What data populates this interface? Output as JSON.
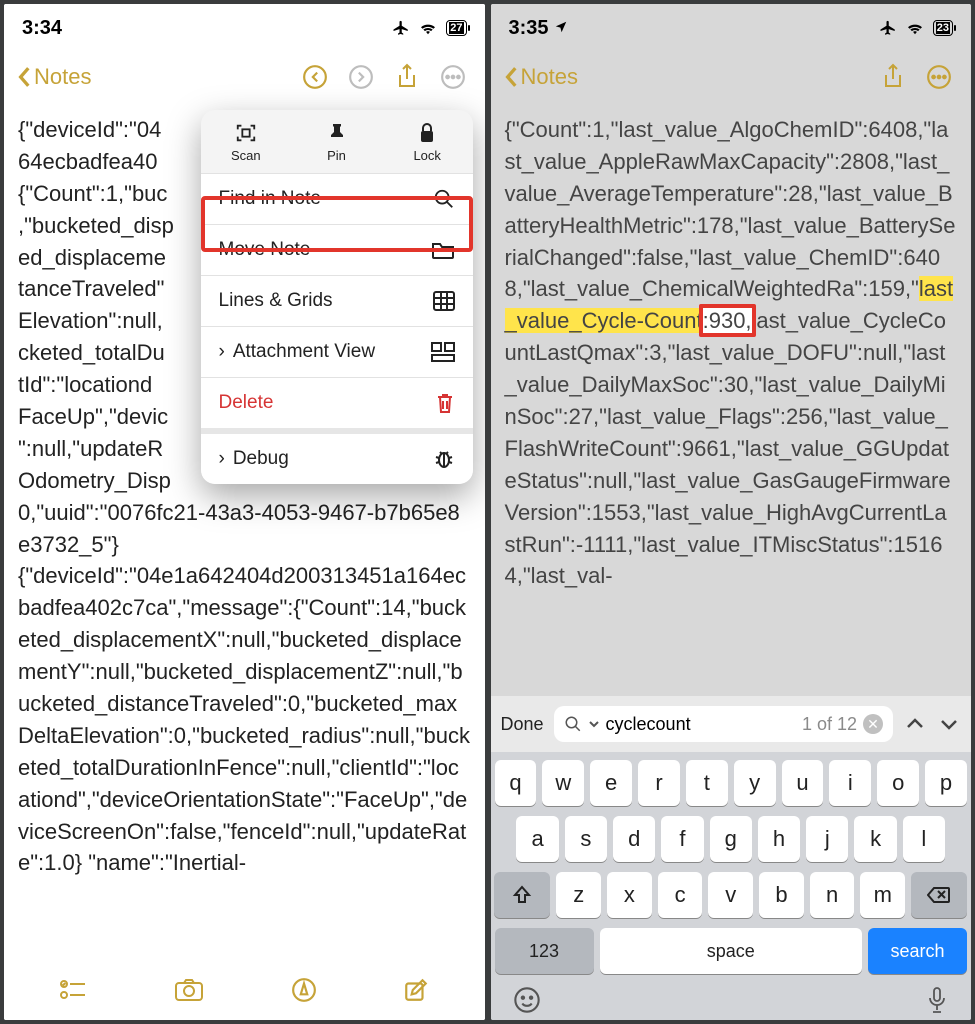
{
  "left": {
    "time": "3:34",
    "battery": "27",
    "back_label": "Notes",
    "note_body_pre": "{\"deviceId\":\"04\n64ecbadfea40\n{\"Count\":1,\"buc\n,\"bucketed_disp\ned_displaceme\ntanceTraveled\"\nElevation\":null,\ncketed_totalDu\ntId\":\"locationd\nFaceUp\",\"devic\n\":null,\"updateR\nOdometry_Disp\n0,\"uuid\":\"0076fc21-43a3-4053-9467-b7b65e8e3732_5\"}\n{\"deviceId\":\"04e1a642404d200313451a164ecbadfea402c7ca\",\"message\":{\"Count\":14,\"bucketed_displacementX\":null,\"bucketed_displacementY\":null,\"bucketed_displacementZ\":null,\"bucketed_distanceTraveled\":0,\"bucketed_maxDeltaElevation\":0,\"bucketed_radius\":null,\"bucketed_totalDurationInFence\":null,\"clientId\":\"locationd\",\"deviceOrientationState\":\"FaceUp\",\"deviceScreenOn\":false,\"fenceId\":null,\"updateRate\":1.0} \"name\":\"Inertial-",
    "menu": {
      "scan": "Scan",
      "pin": "Pin",
      "lock": "Lock",
      "find": "Find in Note",
      "move": "Move Note",
      "lines": "Lines & Grids",
      "attach": "Attachment View",
      "delete": "Delete",
      "debug": "Debug"
    }
  },
  "right": {
    "time": "3:35",
    "battery": "23",
    "back_label": "Notes",
    "body_before": "{\"Count\":1,\"last_value_AlgoChemID\":6408,\"last_value_AppleRawMaxCapacity\":2808,\"last_value_AverageTemperature\":28,\"last_value_BatteryHealthMetric\":178,\"last_value_BatterySerialChanged\":false,\"last_value_ChemID\":6408,\"last_value_ChemicalWeightedRa\":159,\"",
    "hl_yellow_left": "last_value_Cycle-Count",
    "hl_value": ":930,",
    "body_after": "last_value_CycleCountLastQmax\":3,\"last_value_DOFU\":null,\"last_value_DailyMaxSoc\":30,\"last_value_DailyMinSoc\":27,\"last_value_Flags\":256,\"last_value_FlashWriteCount\":9661,\"last_value_GGUpdateStatus\":null,\"last_value_GasGaugeFirmwareVersion\":1553,\"last_value_HighAvgCurrentLastRun\":-1111,\"last_value_ITMiscStatus\":15164,\"last_val-",
    "find": {
      "done": "Done",
      "query": "cyclecount",
      "results": "1 of 12"
    },
    "keys": {
      "r1": [
        "q",
        "w",
        "e",
        "r",
        "t",
        "y",
        "u",
        "i",
        "o",
        "p"
      ],
      "r2": [
        "a",
        "s",
        "d",
        "f",
        "g",
        "h",
        "j",
        "k",
        "l"
      ],
      "r3": [
        "z",
        "x",
        "c",
        "v",
        "b",
        "n",
        "m"
      ],
      "k123": "123",
      "space": "space",
      "search": "search"
    }
  }
}
